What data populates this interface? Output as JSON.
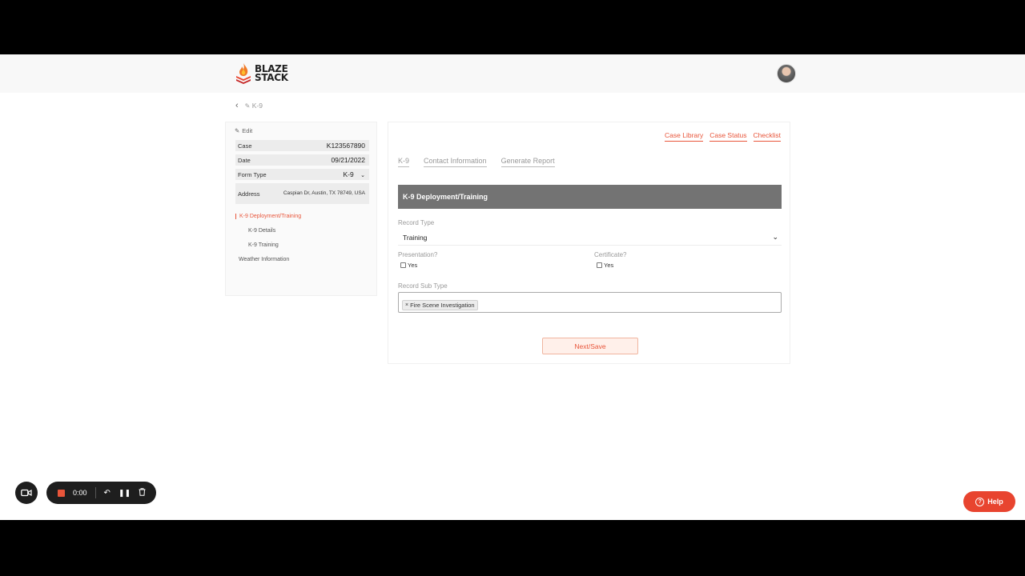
{
  "brand": {
    "line1": "BLAZE",
    "line2": "STACK",
    "accent": "#e8553a"
  },
  "breadcrumb": {
    "back_icon": "chevron-left-icon",
    "current": "K-9"
  },
  "case_panel": {
    "edit_label": "Edit",
    "rows": [
      {
        "label": "Case",
        "value": "K123567890"
      },
      {
        "label": "Date",
        "value": "09/21/2022"
      },
      {
        "label": "Form Type",
        "value": "K-9"
      },
      {
        "label": "Address",
        "value": "Caspian Dr, Austin, TX 78749, USA"
      }
    ],
    "nav": [
      {
        "label": "K-9 Deployment/Training",
        "active": true
      },
      {
        "label": "K-9 Details",
        "active": false
      },
      {
        "label": "K-9 Training",
        "active": false
      },
      {
        "label": "Weather Information",
        "active": false
      }
    ]
  },
  "main": {
    "top_links": [
      "Case Library",
      "Case Status",
      "Checklist"
    ],
    "tabs": [
      "K-9",
      "Contact Information",
      "Generate Report"
    ],
    "section_title": "K-9 Deployment/Training",
    "record_type": {
      "label": "Record Type",
      "value": "Training"
    },
    "presentation": {
      "label": "Presentation?",
      "option": "Yes",
      "checked": false
    },
    "certificate": {
      "label": "Certificate?",
      "option": "Yes",
      "checked": false
    },
    "record_sub_type": {
      "label": "Record Sub Type",
      "tags": [
        "Fire Scene Investigation"
      ]
    },
    "next_button": "Next/Save"
  },
  "recorder": {
    "time": "0:00"
  },
  "help": {
    "label": "Help"
  }
}
